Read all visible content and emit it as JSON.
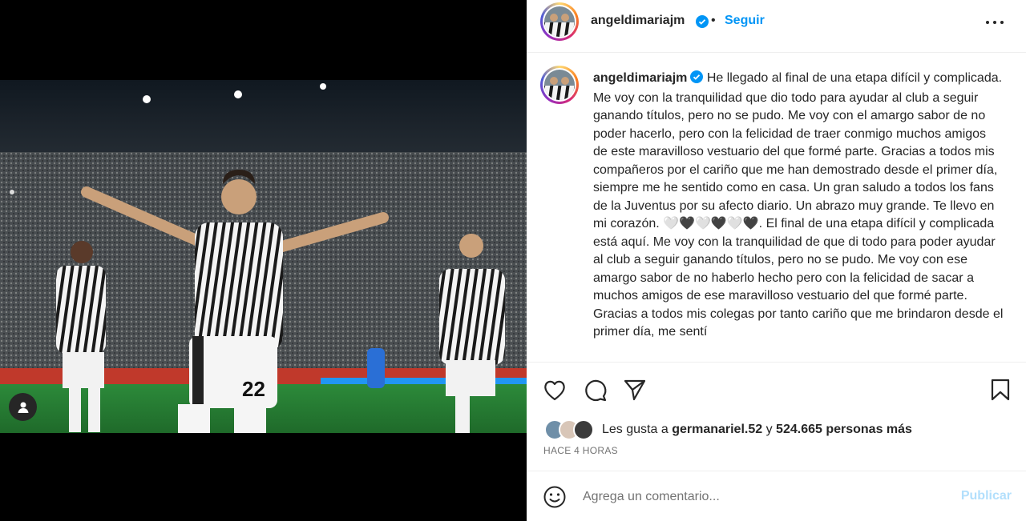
{
  "post": {
    "username": "angeldimariajm",
    "follow_label": "Seguir",
    "more_icon": "more-horizontal-icon",
    "caption": "He llegado al final de una etapa difícil y complicada. Me voy con la tranquilidad que dio todo para ayudar al club a seguir ganando títulos, pero no se pudo. Me voy con el amargo sabor de no poder hacerlo, pero con la felicidad de traer conmigo muchos amigos de este maravilloso vestuario del que formé parte. Gracias a todos mis compañeros por el cariño que me han demostrado desde el primer día, siempre me he sentido como en casa. Un gran saludo a todos los fans de la Juventus por su afecto diario. Un abrazo muy grande. Te llevo en mi corazón. 🤍🖤🤍🖤🤍🖤. El final de una etapa difícil y complicada está aquí. Me voy con la tranquilidad de que di todo para poder ayudar al club a seguir ganando títulos, pero no se pudo. Me voy con ese amargo sabor de no haberlo hecho pero con la felicidad de sacar a muchos amigos de ese maravilloso vestuario del que formé parte. Gracias a todos mis colegas por tanto cariño que me brindaron desde el primer día, me sentí",
    "likes_prefix": "Les gusta a",
    "likes_user": "germanariel.52",
    "likes_join": "y",
    "likes_others": "524.665 personas más",
    "timestamp": "HACE 4 HORAS",
    "comment_placeholder": "Agrega un comentario...",
    "publish_label": "Publicar"
  },
  "colors": {
    "accent": "#0095f6",
    "publish_disabled": "#b2dffc",
    "text": "#262626",
    "muted": "#737373"
  }
}
